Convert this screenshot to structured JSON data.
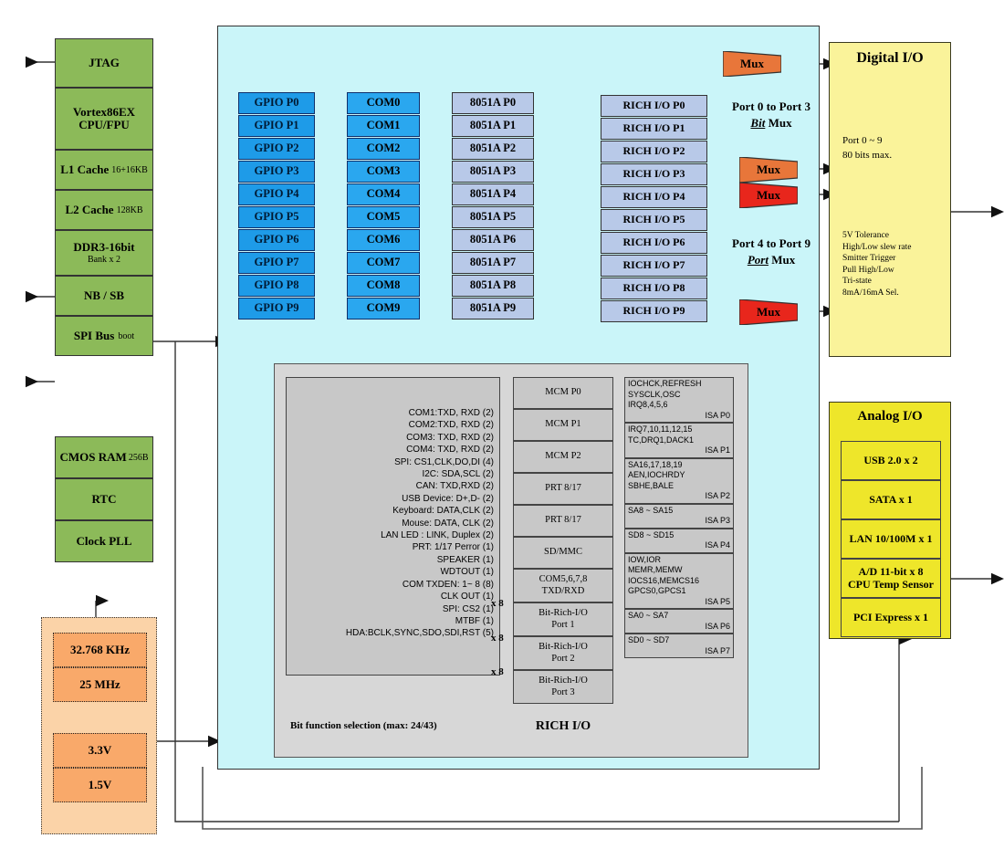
{
  "cpu_stack": {
    "items": [
      {
        "label": "JTAG",
        "sub": ""
      },
      {
        "label": "Vortex86EX",
        "label2": "CPU/FPU",
        "sub": ""
      },
      {
        "label": "L1 Cache",
        "sub": "16+16KB"
      },
      {
        "label": "L2 Cache",
        "sub": "128KB"
      },
      {
        "label": "DDR3-16bit",
        "sub": "Bank x 2"
      },
      {
        "label": "NB / SB",
        "sub": ""
      },
      {
        "label": "SPI Bus",
        "sub": "boot"
      }
    ]
  },
  "misc_stack": {
    "items": [
      {
        "label": "CMOS RAM",
        "sub": "256B"
      },
      {
        "label": "RTC",
        "sub": ""
      },
      {
        "label": "Clock PLL",
        "sub": ""
      }
    ]
  },
  "clock_power": {
    "clocks": [
      "32.768 KHz",
      "25 MHz"
    ],
    "power": [
      "3.3V",
      "1.5V"
    ]
  },
  "columns": {
    "gpio": [
      "GPIO P0",
      "GPIO P1",
      "GPIO P2",
      "GPIO P3",
      "GPIO P4",
      "GPIO P5",
      "GPIO P6",
      "GPIO P7",
      "GPIO P8",
      "GPIO P9"
    ],
    "com": [
      "COM0",
      "COM1",
      "COM2",
      "COM3",
      "COM4",
      "COM5",
      "COM6",
      "COM7",
      "COM8",
      "COM9"
    ],
    "mcu": [
      "8051A P0",
      "8051A P1",
      "8051A P2",
      "8051A P3",
      "8051A P4",
      "8051A P5",
      "8051A P6",
      "8051A P7",
      "8051A P8",
      "8051A P9"
    ],
    "rich": [
      "RICH  I/O P0",
      "RICH  I/O P1",
      "RICH  I/O P2",
      "RICH  I/O P3",
      "RICH  I/O P4",
      "RICH  I/O P5",
      "RICH  I/O P6",
      "RICH  I/O P7",
      "RICH  I/O P8",
      "RICH  I/O P9"
    ]
  },
  "mux": {
    "label": "Mux",
    "note_top_line1": "Port 0 to Port 3",
    "note_top_em": "Bit",
    "note_top_tail": " Mux",
    "note_bottom_line1": "Port 4 to Port 9",
    "note_bottom_em": "Port",
    "note_bottom_tail": " Mux"
  },
  "digital_io": {
    "title": "Digital I/O",
    "ports_line1": "Port 0 ~ 9",
    "ports_line2": "80 bits max.",
    "features": [
      "5V Tolerance",
      "High/Low slew rate",
      "Smitter Trigger",
      "Pull High/Low",
      "Tri-state",
      "8mA/16mA Sel."
    ]
  },
  "analog_io": {
    "title": "Analog I/O",
    "items": [
      {
        "l1": "USB 2.0 x 2",
        "l2": ""
      },
      {
        "l1": "SATA x 1",
        "l2": ""
      },
      {
        "l1": "LAN 10/100M x 1",
        "l2": ""
      },
      {
        "l1": "A/D 11-bit x 8",
        "l2": "CPU Temp Sensor"
      },
      {
        "l1": "PCI Express x 1",
        "l2": ""
      }
    ]
  },
  "rich_panel": {
    "title": "RICH I/O",
    "caption": "Bit function selection  (max: 24/43)",
    "functions": [
      "COM1:TXD, RXD (2)",
      "COM2:TXD, RXD (2)",
      "COM3: TXD, RXD (2)",
      "COM4: TXD, RXD (2)",
      "SPI: CS1,CLK,DO,DI (4)",
      "I2C: SDA,SCL  (2)",
      "CAN: TXD,RXD (2)",
      "USB Device: D+,D- (2)",
      "Keyboard: DATA,CLK (2)",
      "Mouse: DATA, CLK (2)",
      "LAN LED : LINK, Duplex (2)",
      "PRT: 1/17 Perror (1)",
      "SPEAKER (1)",
      "WDTOUT (1)",
      "COM TXDEN: 1~ 8 (8)",
      "CLK OUT (1)",
      "SPI: CS2 (1)",
      "MTBF (1)",
      "HDA:BCLK,SYNC,SDO,SDI,RST (5)"
    ],
    "mid_blocks": [
      {
        "l1": "MCM P0",
        "l2": ""
      },
      {
        "l1": "MCM P1",
        "l2": ""
      },
      {
        "l1": "MCM P2",
        "l2": ""
      },
      {
        "l1": "PRT 8/17",
        "l2": ""
      },
      {
        "l1": "PRT 8/17",
        "l2": ""
      },
      {
        "l1": "SD/MMC",
        "l2": ""
      },
      {
        "l1": "COM5,6,7,8",
        "l2": "TXD/RXD"
      },
      {
        "l1": "Bit-Rich-I/O",
        "l2": "Port 1"
      },
      {
        "l1": "Bit-Rich-I/O",
        "l2": "Port 2"
      },
      {
        "l1": "Bit-Rich-I/O",
        "l2": "Port 3"
      }
    ],
    "x8_labels": [
      "x 8",
      "x 8",
      "x 8"
    ],
    "isa_blocks": [
      {
        "lines": [
          "IOCHCK,REFRESH",
          "SYSCLK,OSC",
          "IRQ8,4,5,6"
        ],
        "tag": "ISA P0"
      },
      {
        "lines": [
          "IRQ7,10,11,12,15",
          "TC,DRQ1,DACK1"
        ],
        "tag": "ISA P1"
      },
      {
        "lines": [
          "SA16,17,18,19",
          "AEN,IOCHRDY",
          "SBHE,BALE"
        ],
        "tag": "ISA P2"
      },
      {
        "lines": [
          "SA8 ~ SA15"
        ],
        "tag": "ISA P3"
      },
      {
        "lines": [
          "SD8 ~ SD15"
        ],
        "tag": "ISA P4"
      },
      {
        "lines": [
          "IOW,IOR",
          "MEMR,MEMW",
          "IOCS16,MEMCS16",
          "GPCS0,GPCS1"
        ],
        "tag": "ISA P5"
      },
      {
        "lines": [
          "SA0 ~ SA7"
        ],
        "tag": "ISA P6"
      },
      {
        "lines": [
          "SD0 ~ SD7"
        ],
        "tag": "ISA P7"
      }
    ]
  },
  "colors": {
    "cpu_green": "#8cba59",
    "gpio_blue": "#1e9be8",
    "mcu_blue": "#b8c9e8",
    "mux_red": "#e8341c",
    "mux_orange": "#e8763a",
    "digital_yellow": "#faf39a",
    "analog_yellow": "#eee62a",
    "panel_cyan": "#caf5f9",
    "power_orange": "#f9a96a"
  }
}
